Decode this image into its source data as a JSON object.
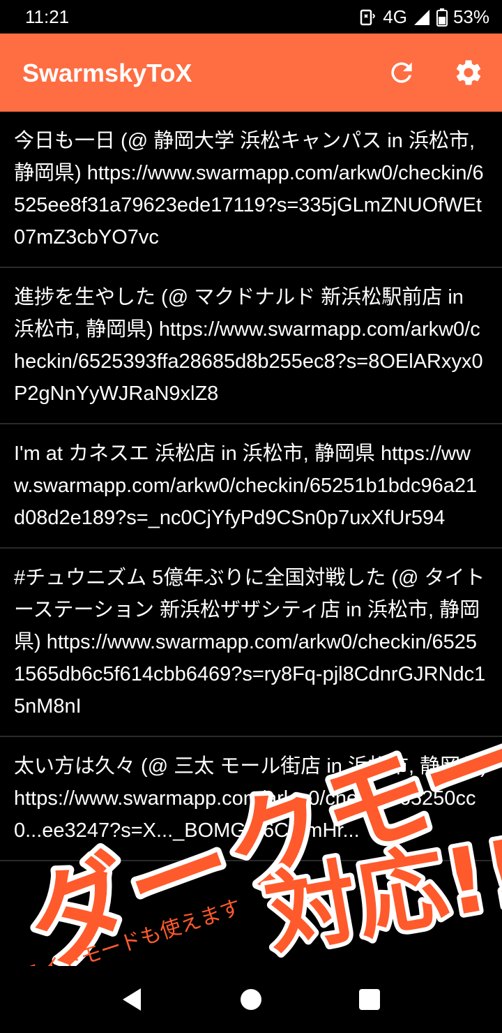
{
  "status_bar": {
    "time": "11:21",
    "network": "4G",
    "battery": "53%"
  },
  "app_bar": {
    "title": "SwarmskyToX",
    "accent_color": "#ff6d42",
    "actions": [
      "refresh-icon",
      "gear-icon"
    ]
  },
  "feed": {
    "items": [
      {
        "text": "今日も一日 (@ 静岡大学 浜松キャンパス in 浜松市, 静岡県) https://www.swarmapp.com/arkw0/checkin/6525ee8f31a79623ede17119?s=335jGLmZNUOfWEt07mZ3cbYO7vc"
      },
      {
        "text": "進捗を生やした (@ マクドナルド 新浜松駅前店 in 浜松市, 静岡県) https://www.swarmapp.com/arkw0/checkin/6525393ffa28685d8b255ec8?s=8OElARxyx0P2gNnYyWJRaN9xlZ8"
      },
      {
        "text": "I'm at カネスエ 浜松店 in 浜松市, 静岡県 https://www.swarmapp.com/arkw0/checkin/65251b1bdc96a21d08d2e189?s=_nc0CjYfyPd9CSn0p7uxXfUr594"
      },
      {
        "text": "#チュウニズム 5億年ぶりに全国対戦した (@ タイトーステーション 新浜松ザザシティ店 in 浜松市, 静岡県) https://www.swarmapp.com/arkw0/checkin/65251565db6c5f614cbb6469?s=ry8Fq-pjl8CdnrGJRNdc15nM8nI"
      },
      {
        "text": "太い方は久々 (@ 三太 モール街店 in 浜松市, 静岡県) https://www.swarmapp.com/arkw0/checkin/65250cc0...ee3247?s=X..._BOMGm6C...mHr..."
      }
    ]
  },
  "promo": {
    "headline": "ダークモード",
    "headline2": "対応!!",
    "subtext": "ライトモードも使えます",
    "color": "#ff5a2c"
  },
  "nav_bar": {
    "buttons": [
      "back-icon",
      "home-icon",
      "recents-icon"
    ]
  }
}
